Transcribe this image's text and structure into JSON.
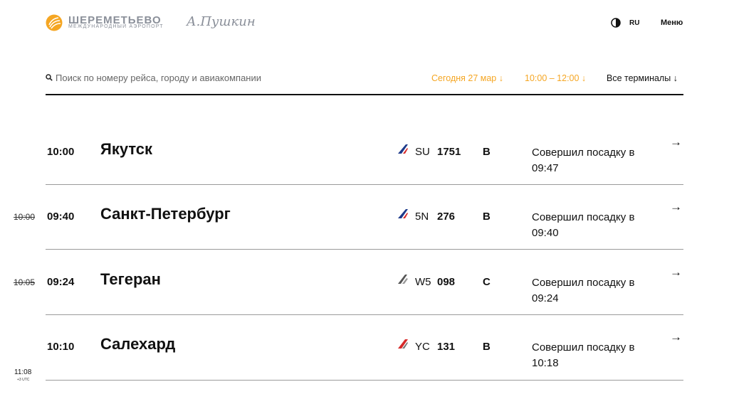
{
  "header": {
    "logo_main": "ШЕРЕМЕТЬЕВО",
    "logo_sub": "МЕЖДУНАРОДНЫЙ АЭРОПОРТ",
    "logo_signature": "А.Пушкин",
    "emblem_icon": "sheremetyevo-wings-logo",
    "contrast_icon": "contrast-icon",
    "language": "RU",
    "menu_label": "Меню"
  },
  "search": {
    "icon": "search-icon",
    "placeholder": "Поиск по номеру рейса, городу и авиакомпании",
    "value": ""
  },
  "filters": {
    "date": "Сегодня 27 мар ↓",
    "time": "10:00 – 12:00 ↓",
    "terminal": "Все терминалы ↓",
    "accent_color": "#f5a623"
  },
  "flights": [
    {
      "old_time": "",
      "time": "10:00",
      "city": "Якутск",
      "airline_logo": "aeroflot-logo",
      "airline_code": "SU",
      "flight_number": "1751",
      "terminal": "B",
      "status": "Совершил посадку в 09:47",
      "arrow": "→"
    },
    {
      "old_time": "10:00",
      "time": "09:40",
      "city": "Санкт-Петербург",
      "airline_logo": "rossiya-logo",
      "airline_code": "5N",
      "flight_number": "276",
      "terminal": "B",
      "status": "Совершил посадку в 09:40",
      "arrow": "→"
    },
    {
      "old_time": "10:05",
      "time": "09:24",
      "city": "Тегеран",
      "airline_logo": "mahan-air-logo",
      "airline_code": "W5",
      "flight_number": "098",
      "terminal": "C",
      "status": "Совершил посадку в 09:24",
      "arrow": "→"
    },
    {
      "old_time": "",
      "time": "10:10",
      "city": "Салехард",
      "airline_logo": "yamal-logo",
      "airline_code": "YC",
      "flight_number": "131",
      "terminal": "B",
      "status": "Совершил посадку в 10:18",
      "arrow": "→"
    }
  ],
  "clock": {
    "time": "11:08",
    "timezone": "+3 UTC"
  }
}
